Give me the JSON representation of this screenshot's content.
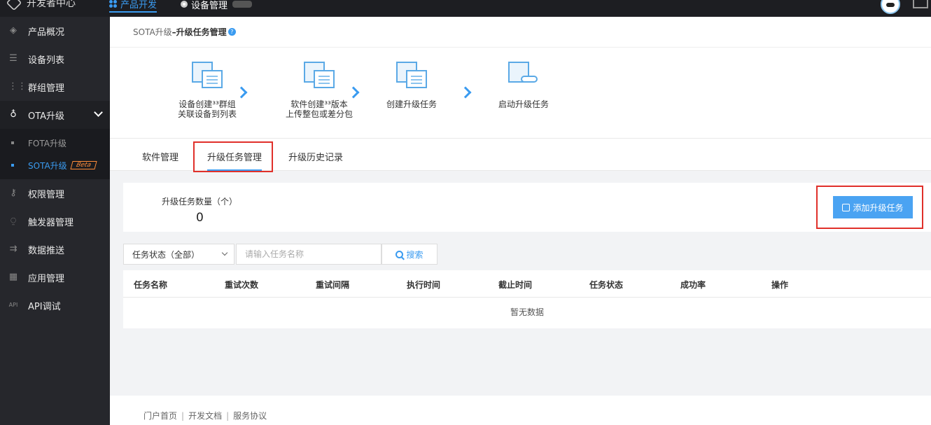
{
  "topbar": {
    "brand": "开发者中心",
    "nav": [
      {
        "label": "产品开发",
        "active": true
      },
      {
        "label": "设备管理",
        "active": false
      }
    ]
  },
  "sidebar": {
    "items": [
      {
        "label": "产品概况",
        "icon": "cube-icon"
      },
      {
        "label": "设备列表",
        "icon": "list-icon"
      },
      {
        "label": "群组管理",
        "icon": "dots-grid-icon"
      },
      {
        "label": "OTA升级",
        "icon": "ota-icon"
      },
      {
        "label": "权限管理",
        "icon": "key-icon"
      },
      {
        "label": "触发器管理",
        "icon": "trigger-icon"
      },
      {
        "label": "数据推送",
        "icon": "push-icon"
      },
      {
        "label": "应用管理",
        "icon": "apps-icon"
      },
      {
        "label": "API调试",
        "icon": "api-icon"
      }
    ],
    "ota_sub": [
      {
        "label": "FOTA升级"
      },
      {
        "label": "SOTA升级",
        "badge": "Beta"
      }
    ]
  },
  "breadcrumb": {
    "parent": "SOTA升级",
    "separator": " – ",
    "current": "升级任务管理",
    "help": "?"
  },
  "steps": [
    {
      "line1": "设备创建³³群组",
      "line2": "关联设备到列表"
    },
    {
      "line1": "软件创建³³版本",
      "line2": "上传整包或差分包"
    },
    {
      "line1": "创建升级任务",
      "line2": ""
    },
    {
      "line1": "启动升级任务",
      "line2": ""
    }
  ],
  "tabs": [
    {
      "label": "软件管理"
    },
    {
      "label": "升级任务管理"
    },
    {
      "label": "升级历史记录"
    }
  ],
  "summary": {
    "label": "升级任务数量（个）",
    "value": "0",
    "add_button": "添加升级任务"
  },
  "filter": {
    "status_select": "任务状态（全部）",
    "search_placeholder": "请输入任务名称",
    "search_button": "搜索"
  },
  "table": {
    "columns": [
      "任务名称",
      "重试次数",
      "重试间隔",
      "执行时间",
      "截止时间",
      "任务状态",
      "成功率",
      "操作"
    ],
    "empty_text": "暂无数据"
  },
  "footer": {
    "links": [
      "门户首页",
      "开发文档",
      "服务协议"
    ]
  },
  "colors": {
    "accent": "#3a9bf0",
    "highlight_border": "#e0302a",
    "sidebar_bg": "#26272c"
  }
}
